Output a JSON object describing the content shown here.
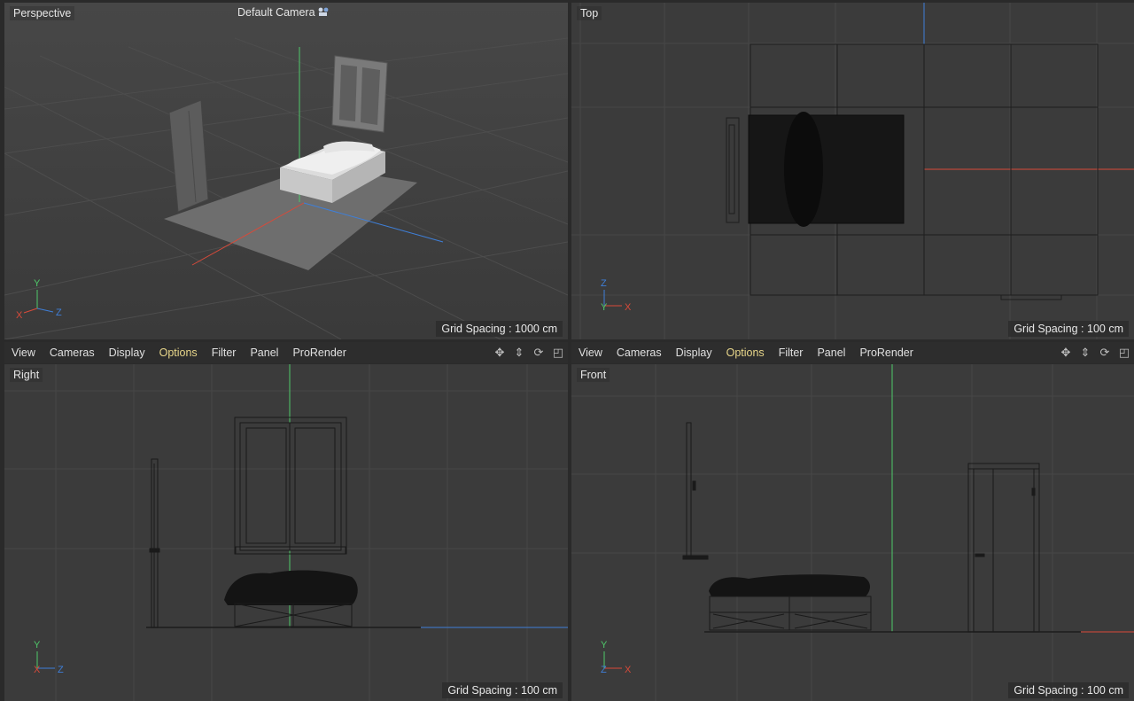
{
  "perspective": {
    "label": "Perspective",
    "camera": "Default Camera",
    "grid_spacing": "Grid Spacing : 1000 cm"
  },
  "top": {
    "label": "Top",
    "grid_spacing": "Grid Spacing : 100 cm"
  },
  "right": {
    "label": "Right",
    "grid_spacing": "Grid Spacing : 100 cm"
  },
  "front": {
    "label": "Front",
    "grid_spacing": "Grid Spacing : 100 cm"
  },
  "menu_left": {
    "items": [
      "View",
      "Cameras",
      "Display",
      "Options",
      "Filter",
      "Panel",
      "ProRender"
    ],
    "active": "Options"
  },
  "menu_right": {
    "items": [
      "View",
      "Cameras",
      "Display",
      "Options",
      "Filter",
      "Panel",
      "ProRender"
    ],
    "active": "Options"
  },
  "axes": {
    "x": "X",
    "y": "Y",
    "z": "Z"
  },
  "tool_icons": [
    "move-view-icon",
    "dolly-view-icon",
    "rotate-view-icon",
    "toggle-maximize-icon"
  ],
  "colors": {
    "x_axis": "#d84a3a",
    "y_axis": "#4fc86a",
    "z_axis": "#3f7fd8",
    "active_menu": "#e8d68a"
  }
}
